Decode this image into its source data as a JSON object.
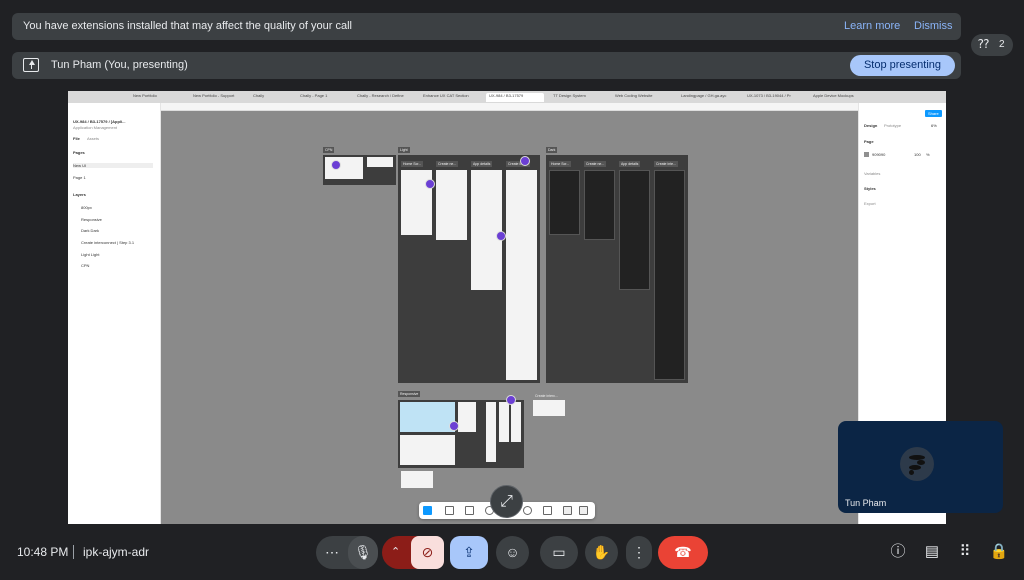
{
  "banner": {
    "message": "You have extensions installed that may affect the quality of your call",
    "learn_more": "Learn more",
    "dismiss": "Dismiss"
  },
  "presenting": {
    "label": "Tun Pham (You, presenting)",
    "stop_button": "Stop presenting"
  },
  "participants": {
    "count": "2"
  },
  "shared_screen": {
    "tabs": [
      "New Portfolio",
      "New Portfolio - Support",
      "Chally",
      "Chally - Page 1",
      "Chally - Research / Define",
      "Enhance UX CAT Section",
      "UX-984 / B3-17579",
      "TT Design System",
      "Web Coding Website",
      "Landingpage / GH.ga.ayc",
      "UX-1073 / B3-19044 / Pr",
      "Apple Device Mockups"
    ],
    "file_title": "UX-984 / B3-17579 / [Appli...",
    "file_subtitle": "Application Management",
    "panel_tabs": [
      "File",
      "Assets"
    ],
    "pages_heading": "Pages",
    "pages": [
      "New UI",
      "Page 1"
    ],
    "layers_heading": "Layers",
    "layers": [
      "800px",
      "Responsive",
      "Dark  Dark",
      "Create interconnect | Step 3.1",
      "Light  Light",
      "CPN"
    ],
    "right_tabs": [
      "Design",
      "Prototype"
    ],
    "zoom": "6%",
    "share": "Share",
    "page_section": "Page",
    "page_color": "909090",
    "page_opacity": "100",
    "percent": "%",
    "variables": "Variables",
    "styles": "Styles",
    "export": "Export",
    "frames": {
      "cpn": "CPN",
      "light": "Light",
      "dark": "Dark",
      "responsive": "Responsive",
      "create_intercon": "Create interc..."
    },
    "columns": [
      "Home Scr...",
      "Create ne...",
      "App details",
      "Create inte..."
    ]
  },
  "self_view": {
    "name": "Tun Pham"
  },
  "footer": {
    "time": "10:48 PM",
    "meeting_code": "ipk-ajym-adr"
  },
  "colors": {
    "background": "#202124",
    "accent": "#a8c7fa",
    "end_call": "#ea4335",
    "camera_off": "#8c1d18"
  }
}
